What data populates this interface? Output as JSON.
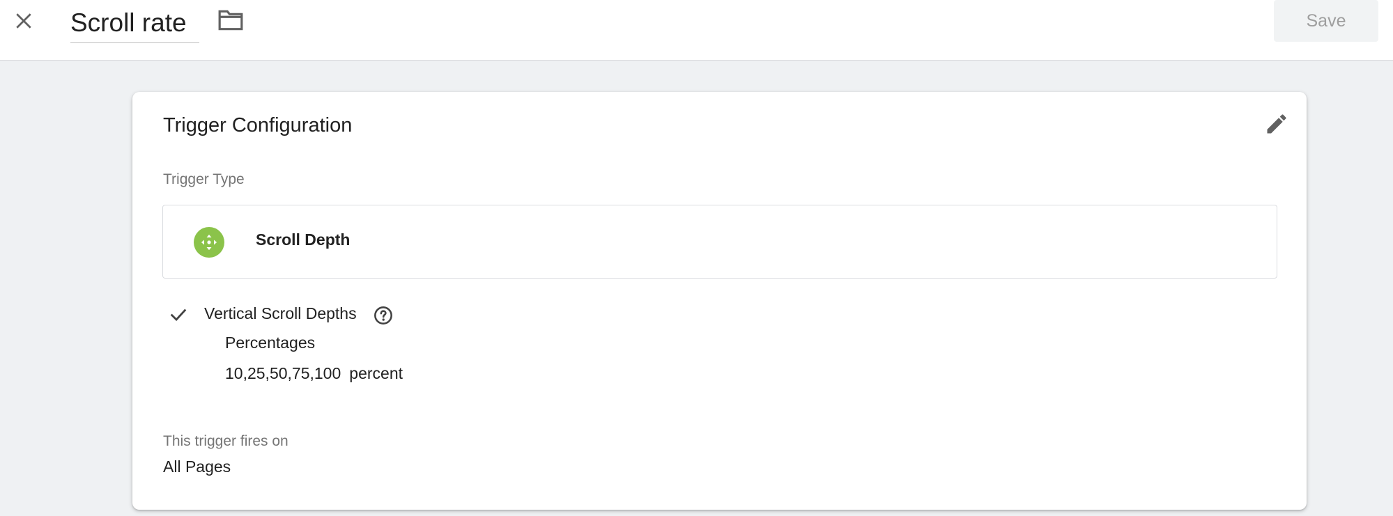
{
  "header": {
    "title": "Scroll rate",
    "save_label": "Save",
    "close_icon": "close-icon",
    "folder_icon": "folder-icon"
  },
  "card": {
    "title": "Trigger Configuration",
    "edit_icon": "pencil-icon",
    "trigger_type_label": "Trigger Type",
    "trigger_type": {
      "name": "Scroll Depth",
      "icon": "scroll-depth-icon",
      "icon_color": "#8bc34a"
    },
    "vertical": {
      "label": "Vertical Scroll Depths",
      "checked": true,
      "help_icon": "help-icon",
      "mode_label": "Percentages",
      "values": "10,25,50,75,100",
      "unit": "percent"
    },
    "fires_on_label": "This trigger fires on",
    "fires_on_value": "All Pages"
  }
}
